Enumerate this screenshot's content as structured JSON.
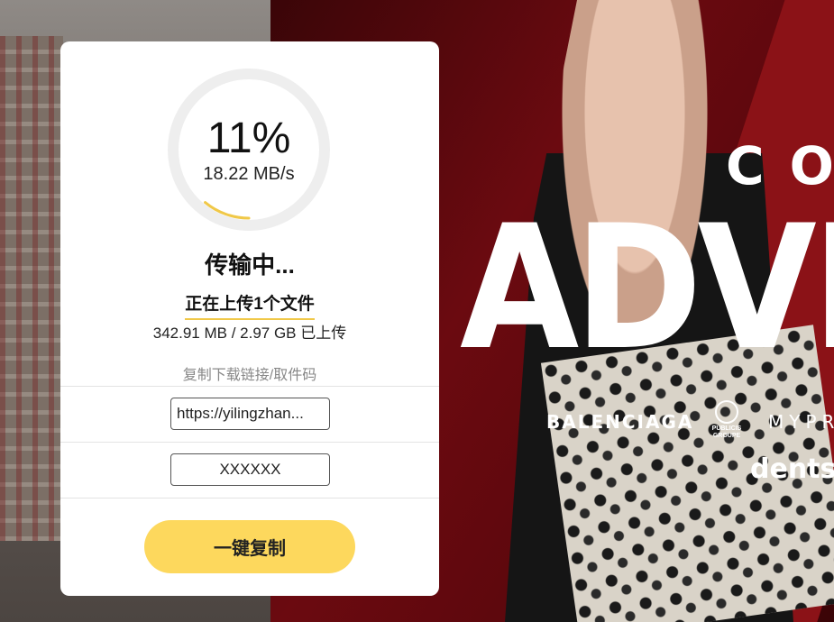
{
  "background": {
    "title_line1": "CO",
    "title_line2": "ADVE",
    "brands": [
      "BALENCIAGA",
      "PUBLICIS GROUPE",
      "MYPR",
      "dentsu"
    ]
  },
  "upload": {
    "progress": 0.11,
    "progress_label": "11%",
    "speed": "18.22 MB/s",
    "status": "传输中...",
    "file_count_text": "正在上传1个文件",
    "size_text": "342.91 MB / 2.97 GB 已上传",
    "copy_hint": "复制下载链接/取件码",
    "link_value": "https://yilingzhan...",
    "code_value": "XXXXXX",
    "copy_button_label": "一键复制"
  },
  "colors": {
    "accent": "#fdd85d",
    "ring_track": "#eeeeee",
    "ring_fill": "#f0c848"
  }
}
